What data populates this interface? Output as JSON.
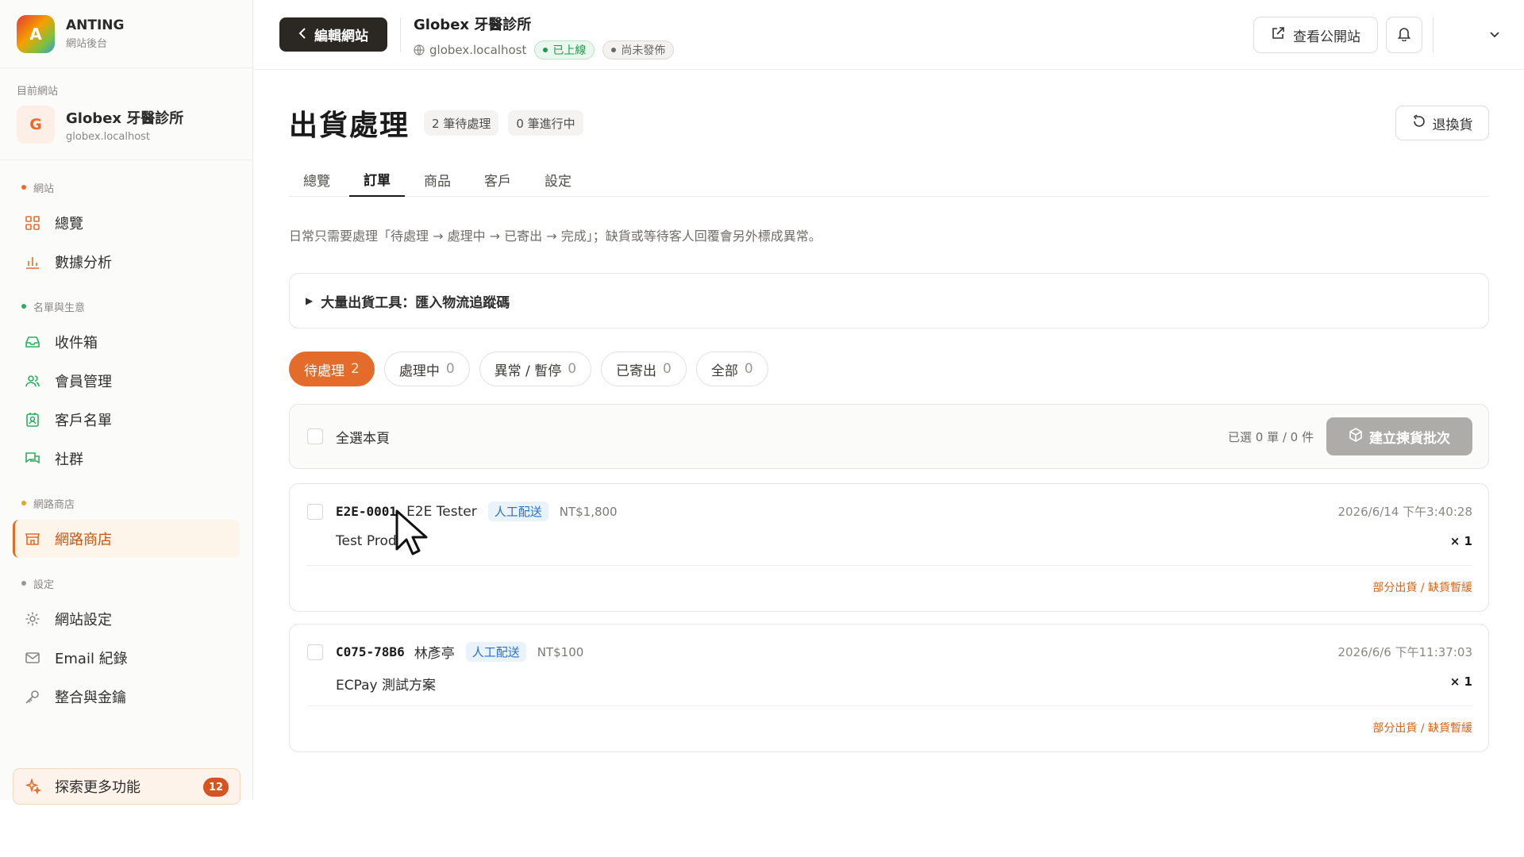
{
  "brand": {
    "logo_letter": "A",
    "name": "ANTING",
    "sub": "網站後台"
  },
  "site": {
    "caption": "目前網站",
    "avatar": "G",
    "name": "Globex 牙醫診所",
    "host": "globex.localhost"
  },
  "sidebar": {
    "sections": [
      {
        "label": "網站",
        "color": "#e46c2a",
        "items": [
          {
            "label": "總覽",
            "icon": "dashboard-icon"
          },
          {
            "label": "數據分析",
            "icon": "bar-chart-icon"
          }
        ]
      },
      {
        "label": "名單與生意",
        "color": "#2fae5f",
        "items": [
          {
            "label": "收件箱",
            "icon": "inbox-icon"
          },
          {
            "label": "會員管理",
            "icon": "users-icon"
          },
          {
            "label": "客戶名單",
            "icon": "contact-icon"
          },
          {
            "label": "社群",
            "icon": "chat-icon"
          }
        ]
      },
      {
        "label": "網路商店",
        "color": "#e4a62a",
        "items": [
          {
            "label": "網路商店",
            "icon": "store-icon",
            "active": true
          }
        ]
      },
      {
        "label": "設定",
        "color": "#9a9893",
        "items": [
          {
            "label": "網站設定",
            "icon": "gear-icon"
          },
          {
            "label": "Email 紀錄",
            "icon": "mail-icon"
          },
          {
            "label": "整合與金鑰",
            "icon": "key-icon"
          }
        ]
      }
    ],
    "explore": {
      "label": "探索更多功能",
      "badge": "12"
    }
  },
  "topbar": {
    "edit_label": "編輯網站",
    "site_name": "Globex 牙醫診所",
    "host": "globex.localhost",
    "status_live": "已上線",
    "status_draft": "尚未發佈",
    "public_label": "查看公開站"
  },
  "page": {
    "title": "出貨處理",
    "pending_chip": "2 筆待處理",
    "inprogress_chip": "0 筆進行中",
    "returns_label": "退換貨",
    "tabs": [
      "總覽",
      "訂單",
      "商品",
      "客戶",
      "設定"
    ],
    "active_tab": 1,
    "hint": "日常只需要處理「待處理 → 處理中 → 已寄出 → 完成」；缺貨或等待客人回覆會另外標成異常。",
    "bulk_tool": "大量出貨工具：匯入物流追蹤碼",
    "filters": [
      {
        "label": "待處理",
        "count": "2",
        "active": true
      },
      {
        "label": "處理中",
        "count": "0"
      },
      {
        "label": "異常 / 暫停",
        "count": "0"
      },
      {
        "label": "已寄出",
        "count": "0"
      },
      {
        "label": "全部",
        "count": "0"
      }
    ],
    "select_all": "全選本頁",
    "selected_stat": "已選 0 單 / 0 件",
    "batch_label": "建立揀貨批次"
  },
  "orders": [
    {
      "id": "E2E-0001",
      "customer": "E2E Tester",
      "shipping": "人工配送",
      "amount": "NT$1,800",
      "date": "2026/6/14 下午3:40:28",
      "product": "Test Prod",
      "qty": "× 1",
      "flag": "部分出貨 / 缺貨暫緩"
    },
    {
      "id": "C075-78B6",
      "customer": "林彥亭",
      "shipping": "人工配送",
      "amount": "NT$100",
      "date": "2026/6/6 下午11:37:03",
      "product": "ECPay 測試方案",
      "qty": "× 1",
      "flag": "部分出貨 / 缺貨暫緩"
    }
  ]
}
